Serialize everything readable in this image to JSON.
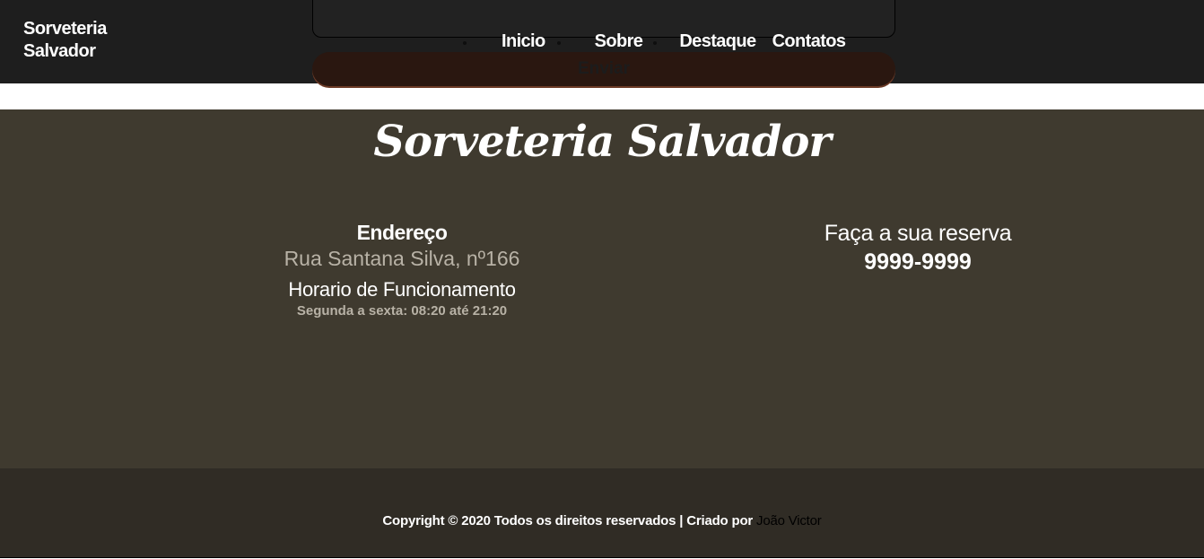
{
  "header": {
    "brand": "Sorveteria Salvador",
    "nav": [
      {
        "label": "Inicio"
      },
      {
        "label": "Sobre"
      },
      {
        "label": "Destaque"
      },
      {
        "label": "Contatos"
      }
    ],
    "form": {
      "send_label": "Enviar"
    }
  },
  "info": {
    "title": "Sorveteria Salvador",
    "address_heading": "Endereço",
    "address": "Rua Santana Silva, nº166",
    "hours_heading": "Horario de Funcionamento",
    "hours": "Segunda a sexta: 08:20 até 21:20",
    "reserve_text": "Faça a sua reserva",
    "phone": "9999-9999"
  },
  "footer": {
    "copyright_text": "Copyright © 2020 Todos os direitos reservados | Criado por",
    "author": "João Victor"
  },
  "colors": {
    "header_bg": "#1e1e1e",
    "info_bg": "#3f3a2f",
    "footer_bg": "#302c25",
    "muted_text": "#b8b2a6"
  }
}
